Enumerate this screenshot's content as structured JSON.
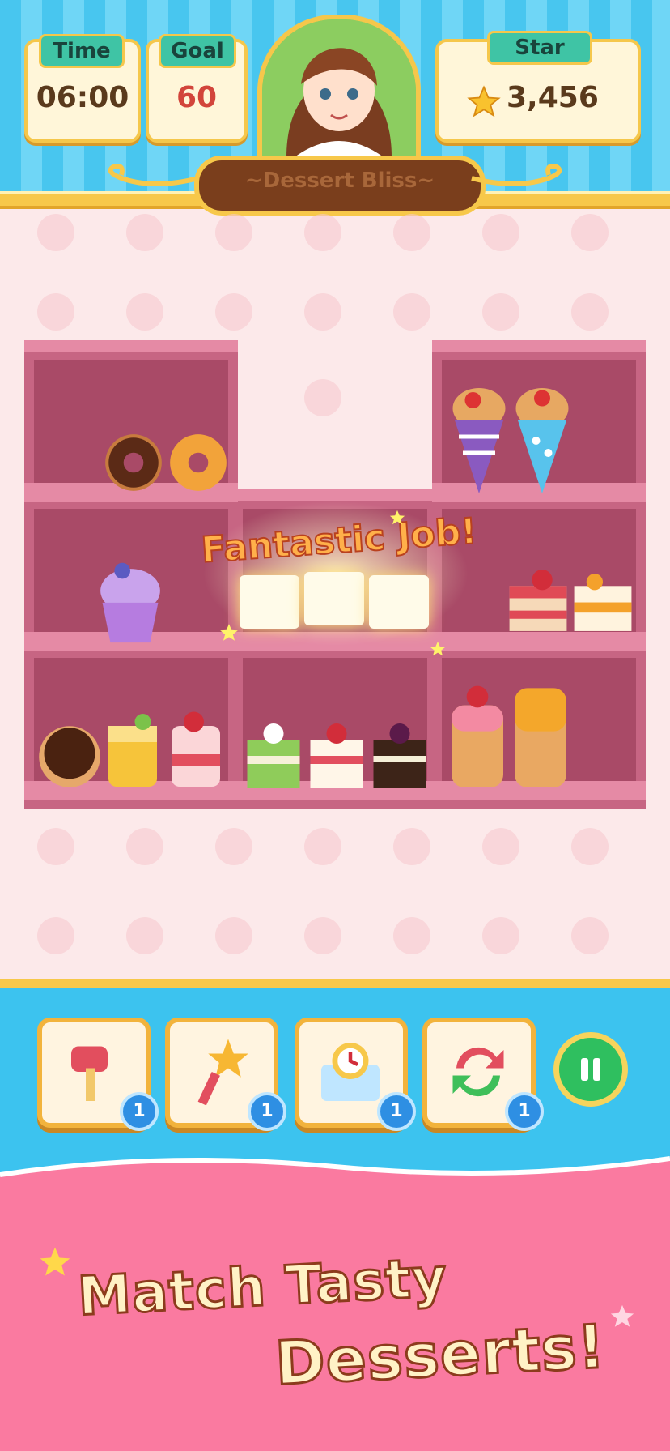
{
  "hud": {
    "time_label": "Time",
    "time_value": "06:00",
    "goal_label": "Goal",
    "goal_value": "60",
    "star_label": "Star",
    "star_value": "3,456"
  },
  "level_title": "~Dessert Bliss~",
  "board": {
    "banner": "Fantastic Job!",
    "shelves": [
      {
        "row": 1,
        "items": [
          "chocolate-donut-ring",
          "orange-donut-ring",
          "",
          "",
          "",
          "",
          "crepe-purple",
          "crepe-blue"
        ]
      },
      {
        "row": 2,
        "items": [
          "blueberry-cupcake",
          "",
          "",
          "cake-slice-glowing",
          "cake-slice-glowing",
          "cake-slice-glowing",
          "strawberry-cake",
          "mango-cake"
        ]
      },
      {
        "row": 3,
        "items": [
          "chocolate-donut",
          "mango-pudding",
          "strawberry-pudding",
          "matcha-cake",
          "strawberry-shortcake",
          "chocolate-cake",
          "strawberry-pancakes",
          "honey-pancakes"
        ]
      }
    ]
  },
  "tools": [
    {
      "name": "hammer",
      "count": "1"
    },
    {
      "name": "magic-wand",
      "count": "1"
    },
    {
      "name": "freeze-clock",
      "count": "1"
    },
    {
      "name": "shuffle",
      "count": "1"
    }
  ],
  "promo": {
    "line1": "Match Tasty",
    "line2": "Desserts!"
  },
  "colors": {
    "header_blue": "#48c6ef",
    "gold": "#f7c84a",
    "shelf": "#c76583",
    "promo_pink": "#fa7aa0"
  }
}
